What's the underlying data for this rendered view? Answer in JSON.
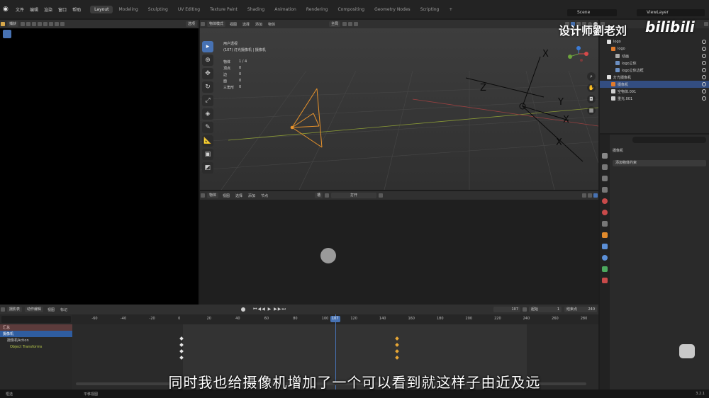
{
  "topbar": {
    "menus": [
      "文件",
      "编辑",
      "渲染",
      "窗口",
      "帮助"
    ],
    "workspaces": [
      "Layout",
      "Modeling",
      "Sculpting",
      "UV Editing",
      "Texture Paint",
      "Shading",
      "Animation",
      "Rendering",
      "Compositing",
      "Geometry Nodes",
      "Scripting"
    ],
    "active_workspace": "Layout",
    "scene": "Scene",
    "view_layer": "ViewLayer"
  },
  "left_header": {
    "mode": "捕获",
    "options": "选项"
  },
  "viewport": {
    "mode": "物体模式",
    "menus": [
      "视图",
      "选择",
      "添加",
      "物体"
    ],
    "global": "全局",
    "view_name": "用户透视",
    "collection": "(107) 灯光摄像机 | 摄像机",
    "stats": [
      {
        "label": "物体",
        "value": "1 / 4"
      },
      {
        "label": "顶点",
        "value": "0"
      },
      {
        "label": "边",
        "value": "0"
      },
      {
        "label": "面",
        "value": "0"
      },
      {
        "label": "三角形",
        "value": "0"
      }
    ],
    "axis_labels": [
      "X",
      "Y",
      "Z"
    ]
  },
  "node_editor": {
    "type": "物体",
    "menus": [
      "视图",
      "选择",
      "添加",
      "节点"
    ],
    "slot": "槽",
    "new_label": "打开"
  },
  "timeline": {
    "mode": "摄影表",
    "submode": "动作编辑",
    "menus": [
      "视图",
      "标记"
    ],
    "current_frame": "107",
    "start_label": "起始",
    "start": "1",
    "end_label": "结束点",
    "end": "240",
    "ruler": [
      "-60",
      "-40",
      "-20",
      "0",
      "20",
      "40",
      "60",
      "80",
      "100",
      "120",
      "140",
      "160",
      "180",
      "200",
      "220",
      "240",
      "260",
      "280"
    ],
    "channels": [
      {
        "label": "汇总",
        "kind": "summary"
      },
      {
        "label": "摄像机",
        "kind": "object"
      },
      {
        "label": "摄像机Action",
        "kind": "action"
      },
      {
        "label": "Object Transforms",
        "kind": "group"
      }
    ],
    "keyframes_frames": [
      0,
      150
    ]
  },
  "outliner": {
    "items": [
      {
        "label": "logo",
        "depth": 1,
        "color": "#e0e0e0"
      },
      {
        "label": "logo",
        "depth": 2,
        "color": "#e07a2c"
      },
      {
        "label": "动画",
        "depth": 3,
        "color": "#aaaaaa"
      },
      {
        "label": "logo立体",
        "depth": 3,
        "color": "#6b8fc2"
      },
      {
        "label": "logo立体边框",
        "depth": 3,
        "color": "#6b8fc2"
      },
      {
        "label": "灯光摄像机",
        "depth": 1,
        "color": "#e0e0e0"
      },
      {
        "label": "摄像机",
        "depth": 2,
        "color": "#e07a2c",
        "selected": true
      },
      {
        "label": "空物体.001",
        "depth": 2,
        "color": "#cfcfcf"
      },
      {
        "label": "重光.001",
        "depth": 2,
        "color": "#cfcfcf"
      }
    ]
  },
  "properties": {
    "object_name": "摄像机",
    "add_constraint": "添加物体约束"
  },
  "status": {
    "left": "框选",
    "middle": "平移视图",
    "version": "3.2.1"
  },
  "subtitle": "同时我也给摄像机增加了一个可以看到就这样子由近及远",
  "watermark": "设计师劉老刘",
  "brand": "bilibili"
}
